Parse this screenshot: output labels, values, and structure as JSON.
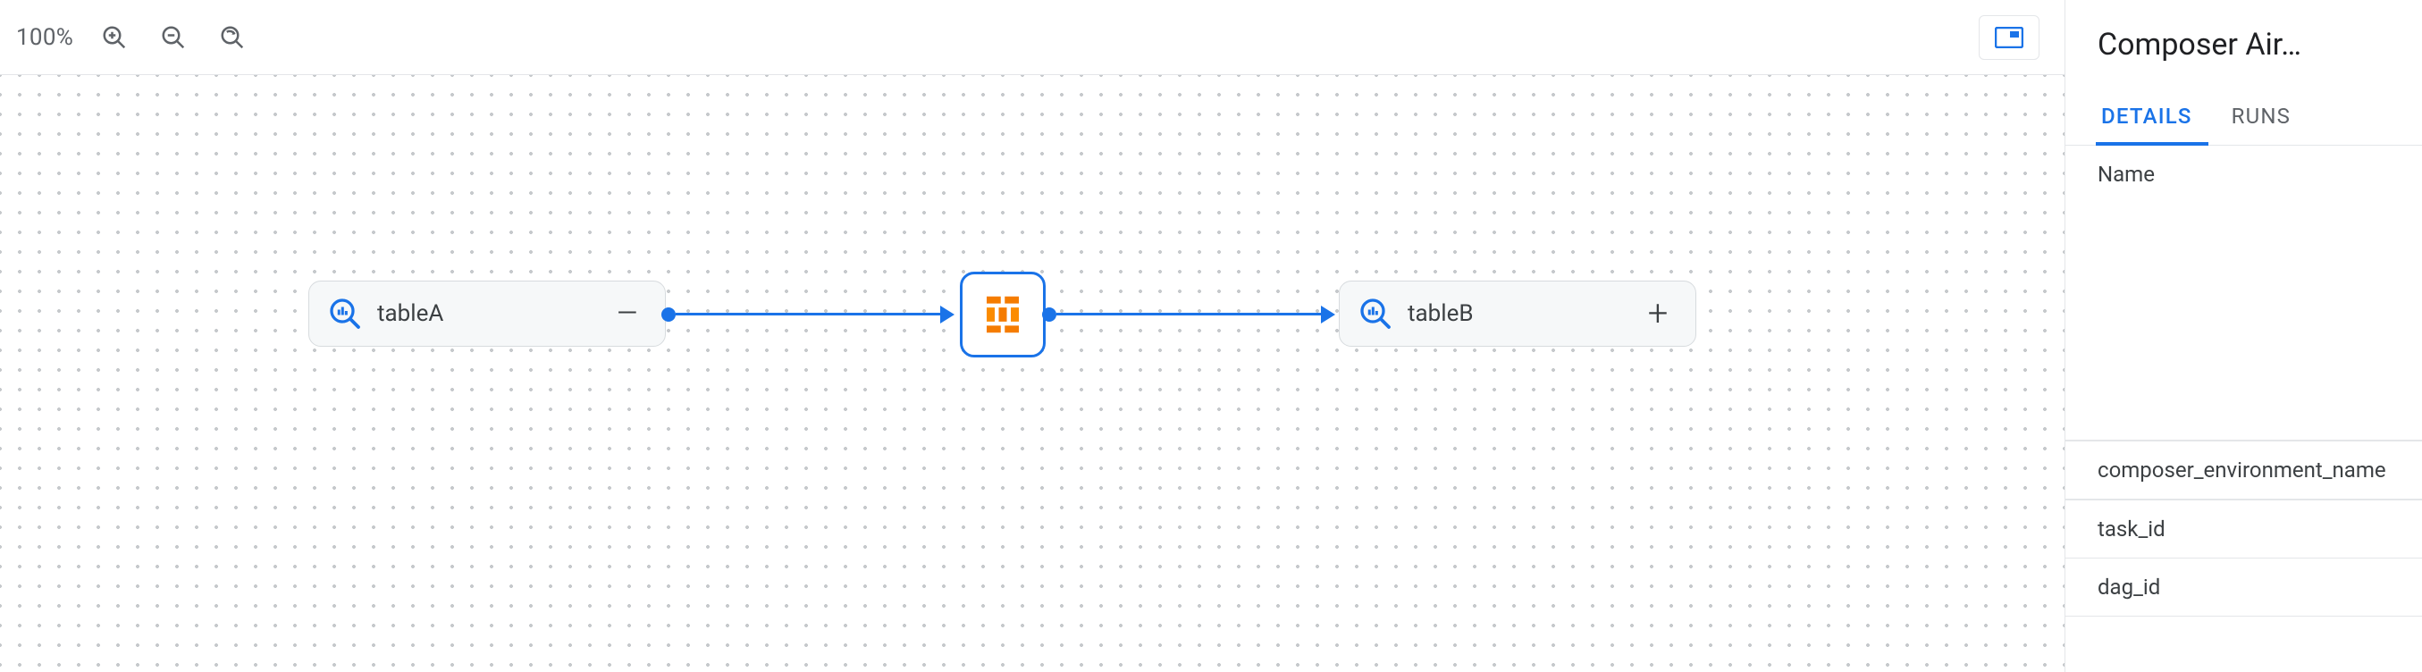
{
  "toolbar": {
    "zoom_label": "100%"
  },
  "canvas": {
    "nodes": {
      "left": {
        "label": "tableA",
        "toggle_glyph": "–"
      },
      "right": {
        "label": "tableB",
        "toggle_glyph": "+"
      }
    }
  },
  "panel": {
    "title": "Composer Air…",
    "tabs": {
      "details": "DETAILS",
      "runs": "RUNS"
    },
    "fields": {
      "name_label": "Name",
      "env_label": "composer_environment_name",
      "task_label": "task_id",
      "dag_label": "dag_id"
    }
  }
}
